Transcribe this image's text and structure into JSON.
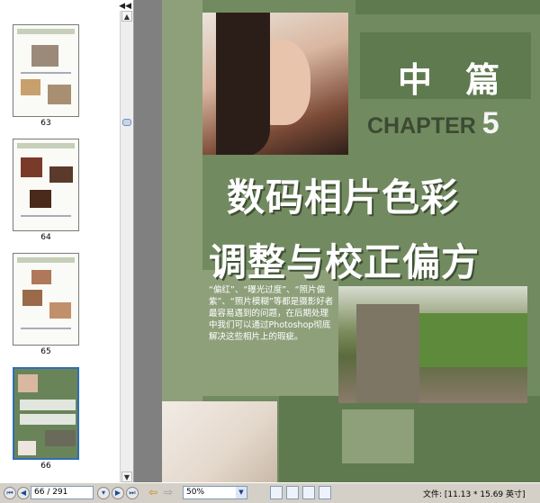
{
  "sidebar": {
    "thumbnails": [
      {
        "label": "63"
      },
      {
        "label": "64"
      },
      {
        "label": "65"
      },
      {
        "label": "66"
      }
    ]
  },
  "page": {
    "heading": "中 篇",
    "chapter_word": "CHAPTER",
    "chapter_number": "5",
    "title_line1": "数码相片色彩",
    "title_line2": "调整与校正偏方",
    "description": "“偏红”、“曝光过度”、“照片偏紫”、“照片模糊”等都是摄影好者最容易遇到的问题，在后期处理中我们可以通过Photoshop彻底解决这些相片上的瑕疵。"
  },
  "statusbar": {
    "page_field": "66 / 291",
    "zoom_value": "50%",
    "file_info": "文件: [11.13 * 15.69 英寸]"
  },
  "colors": {
    "page_green": "#728a60",
    "dark_panel": "#5f7a4e"
  }
}
